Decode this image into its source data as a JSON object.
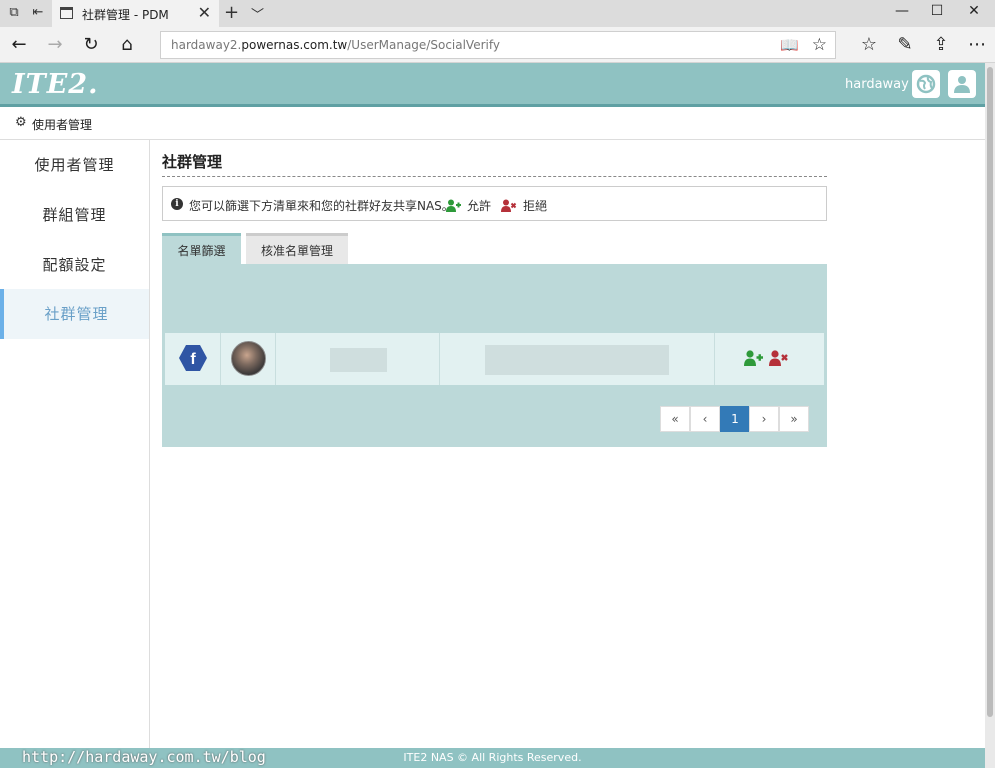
{
  "browser": {
    "tab_title": "社群管理 - PDM",
    "url_prefix": "hardaway2.",
    "url_host": "powernas.com.tw",
    "url_path": "/UserManage/SocialVerify"
  },
  "header": {
    "logo": "ITE2.",
    "username": "hardaway"
  },
  "breadcrumb": {
    "label": "使用者管理"
  },
  "sidebar": {
    "items": [
      {
        "label": "使用者管理"
      },
      {
        "label": "群組管理"
      },
      {
        "label": "配額設定"
      },
      {
        "label": "社群管理"
      }
    ]
  },
  "main": {
    "title": "社群管理",
    "info": {
      "text": "您可以篩選下方清單來和您的社群好友共享NAS。",
      "allow_label": "允許",
      "deny_label": "拒絕"
    },
    "tabs": [
      {
        "label": "名單篩選"
      },
      {
        "label": "核准名單管理"
      }
    ],
    "pagination": {
      "first": "«",
      "prev": "‹",
      "current": "1",
      "next": "›",
      "last": "»"
    }
  },
  "footer": {
    "copyright": "ITE2 NAS © All Rights Reserved.",
    "watermark": "http://hardaway.com.tw/blog"
  },
  "colors": {
    "header_bg": "#8fc2c2",
    "panel_bg": "#bcd9d9",
    "allow": "#2e9a3a",
    "deny": "#b5313a",
    "page_active": "#337ab7",
    "facebook": "#2f55a4"
  }
}
